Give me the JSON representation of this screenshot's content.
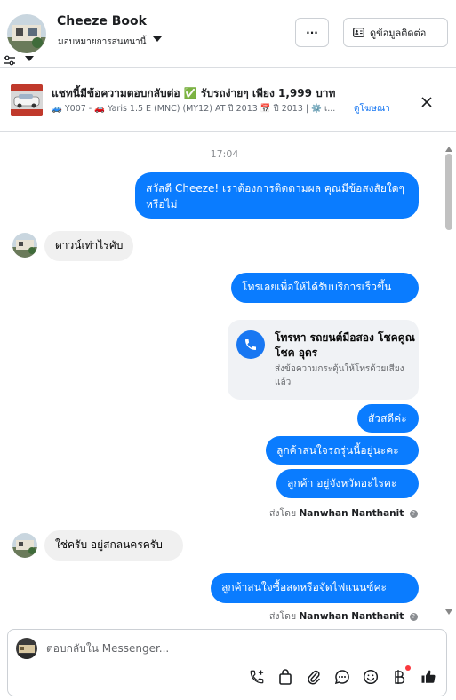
{
  "header": {
    "name": "Cheeze Book",
    "assign_label": "มอบหมายการสนทนานี้",
    "more_label": "···",
    "contact_info_label": "ดูข้อมูลติดต่อ"
  },
  "ad": {
    "title": "แชทนี้มีข้อความตอบกลับต่อ ✅ รับรถง่ายๆ เพียง 1,999 บาท",
    "subtitle": "🚙 Y007 - 🚗 Yaris 1.5 E (MNC) (MY12) AT ปี 2013 📅 ปี 2013 | ⚙️ เ...",
    "link_label": "ดูโฆษณา"
  },
  "conversation": {
    "timestamp": "17:04",
    "messages": [
      {
        "text": "สวัสดี Cheeze! เราต้องการติดตามผล คุณมีข้อสงสัยใดๆ หรือไม่"
      },
      {
        "text": "ดาวน์เท่าไรคับ"
      },
      {
        "text": "โทรเลยเพื่อให้ได้รับบริการเร็วขึ้น"
      },
      {
        "text": "สัวสดีค่ะ"
      },
      {
        "text": "ลูกค้าสนใจรถรุ่นนี้อยู่นะคะ"
      },
      {
        "text": "ลูกค้า อยู่จังหวัดอะไรคะ"
      },
      {
        "text": "ใช่ครับ อยู่สกลนครครับ"
      },
      {
        "text": "ลูกค้าสนใจซื้อสดหรือจัดไฟแนนซ์คะ"
      }
    ],
    "call_card": {
      "title": "โทรหา รถยนต์มือสอง โชคคูณโชค อุดร",
      "subtitle": "ส่งข้อความกระตุ้นให้โทรด้วยเสียงแล้ว"
    },
    "sent_by": {
      "prefix": "ส่งโดย",
      "name": "Nanwhan Nanthanit",
      "info": "?"
    }
  },
  "composer": {
    "placeholder": "ตอบกลับใน Messenger..."
  },
  "colors": {
    "outgoing_bubble": "#0a7cff",
    "incoming_bubble": "#f0f0f0",
    "accent": "#1877f2"
  },
  "icons": {
    "composer_tools": [
      "add-call-icon",
      "shopping-bag-icon",
      "paperclip-icon",
      "chat-bubble-icon",
      "emoji-icon",
      "baht-icon",
      "thumbs-up-icon"
    ]
  }
}
